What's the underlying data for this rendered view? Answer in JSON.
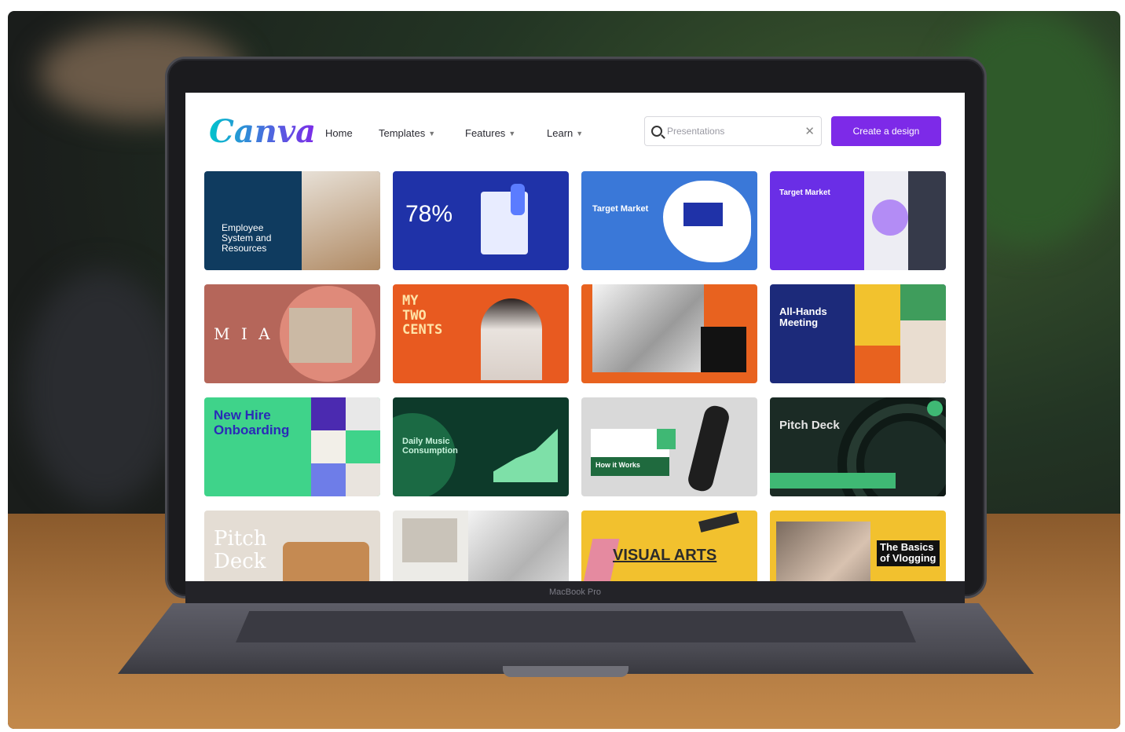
{
  "device": {
    "label": "MacBook Pro"
  },
  "app": {
    "logo": "Canva",
    "nav": [
      {
        "label": "Home",
        "has_dropdown": false
      },
      {
        "label": "Templates",
        "has_dropdown": true
      },
      {
        "label": "Features",
        "has_dropdown": true
      },
      {
        "label": "Learn",
        "has_dropdown": true
      }
    ],
    "search": {
      "placeholder": "Presentations",
      "icon": "search-icon",
      "clear_icon": "close-icon"
    },
    "cta_label": "Create a design",
    "colors": {
      "accent": "#7d2ae8"
    }
  },
  "templates": [
    {
      "title": "Employee System and Resources",
      "bg": "#0f3b5f"
    },
    {
      "title": "78%",
      "bg": "#1f32a8"
    },
    {
      "title": "Target Market",
      "bg": "#3a78d8"
    },
    {
      "title": "Target Market",
      "bg": "#6a2ee6"
    },
    {
      "title": "M I A",
      "bg": "#b5665a"
    },
    {
      "title": "MY TWO CENTS",
      "bg": "#e85a20"
    },
    {
      "title": "",
      "bg": "#e8621f"
    },
    {
      "title": "All-Hands Meeting",
      "bg": "#1c2a7a"
    },
    {
      "title": "New Hire Onboarding",
      "bg": "#3fd38a"
    },
    {
      "title": "Daily Music Consumption",
      "bg": "#0d3a2a"
    },
    {
      "title": "How it Works",
      "bg": "#d9d9d9"
    },
    {
      "title": "Pitch Deck",
      "bg": "#1b2b25"
    },
    {
      "title": "Pitch Deck",
      "bg": "#e4ddd4"
    },
    {
      "title": "",
      "bg": "#ecebe7"
    },
    {
      "title": "VISUAL ARTS",
      "bg": "#f2c12e"
    },
    {
      "title": "The Basics of Vlogging",
      "bg": "#f2c12e"
    }
  ]
}
